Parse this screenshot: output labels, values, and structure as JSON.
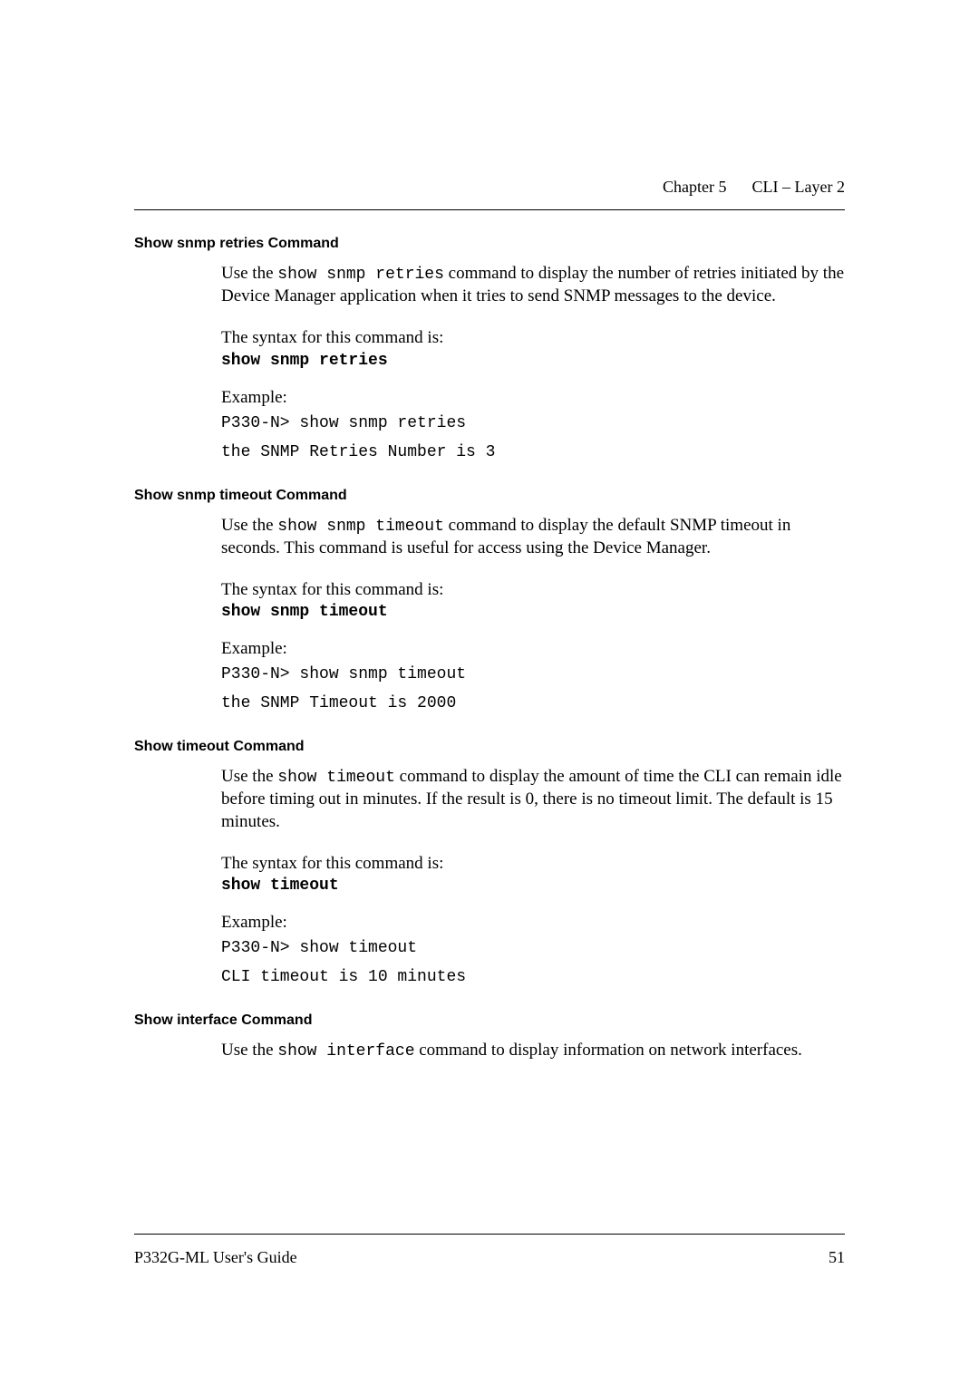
{
  "header": {
    "chapter": "Chapter 5",
    "title": "CLI – Layer 2"
  },
  "sections": [
    {
      "heading": "Show snmp retries Command",
      "intro_pre": "Use the ",
      "intro_cmd": "show snmp retries",
      "intro_post": " command to display the number of retries initiated by the Device Manager application when it tries to send SNMP messages to the device.",
      "syntax_label": "The syntax for this command is:",
      "syntax_cmd": "show snmp retries",
      "example_label": "Example:",
      "example_lines": [
        "P330-N> show snmp retries",
        "the SNMP Retries Number is 3"
      ]
    },
    {
      "heading": "Show snmp timeout Command",
      "intro_pre": "Use the ",
      "intro_cmd": "show snmp timeout",
      "intro_post": " command to display the default SNMP timeout in seconds. This command is useful for access using the Device Manager.",
      "syntax_label": "The syntax for this command is:",
      "syntax_cmd": "show snmp timeout",
      "example_label": "Example:",
      "example_lines": [
        "P330-N> show snmp timeout",
        "the SNMP Timeout is 2000"
      ]
    },
    {
      "heading": "Show timeout Command",
      "intro_pre": "Use the ",
      "intro_cmd": "show timeout",
      "intro_post": " command to display the amount of time the CLI can remain idle before timing out in minutes. If the result is 0, there is no timeout limit. The default is 15 minutes.",
      "syntax_label": "The syntax for this command is:",
      "syntax_cmd": "show timeout",
      "example_label": "Example:",
      "example_lines": [
        "P330-N> show timeout",
        "CLI timeout is 10 minutes"
      ]
    },
    {
      "heading": "Show interface Command",
      "intro_pre": "Use the ",
      "intro_cmd": "show interface",
      "intro_post": " command to display information on network interfaces.",
      "syntax_label": "",
      "syntax_cmd": "",
      "example_label": "",
      "example_lines": []
    }
  ],
  "footer": {
    "guide": "P332G-ML User's Guide",
    "page": "51"
  }
}
